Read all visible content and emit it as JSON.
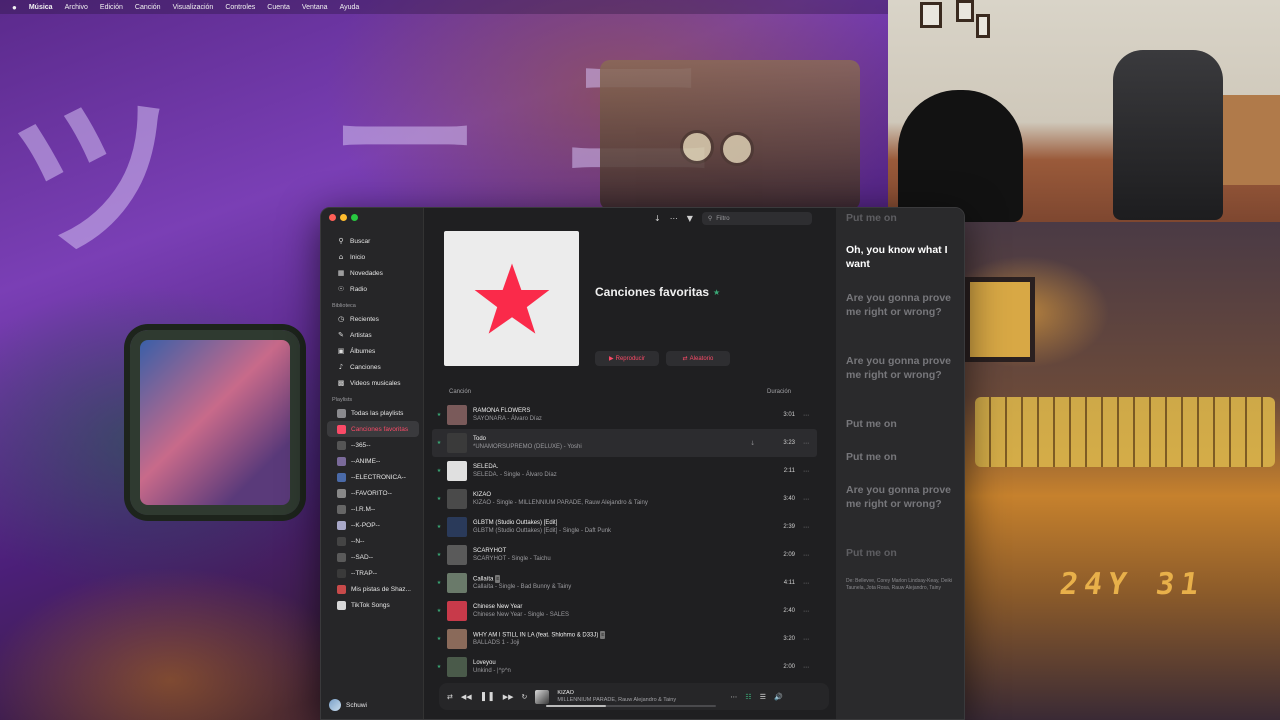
{
  "menubar": {
    "apple": "",
    "items": [
      "Música",
      "Archivo",
      "Edición",
      "Canción",
      "Visualización",
      "Controles",
      "Cuenta",
      "Ventana",
      "Ayuda"
    ]
  },
  "sidebar": {
    "main": [
      {
        "label": "Buscar",
        "icon": "search-icon"
      },
      {
        "label": "Inicio",
        "icon": "home-icon"
      },
      {
        "label": "Novedades",
        "icon": "grid-icon"
      },
      {
        "label": "Radio",
        "icon": "radio-icon"
      }
    ],
    "library_heading": "Biblioteca",
    "library": [
      {
        "label": "Recientes",
        "icon": "clock-icon"
      },
      {
        "label": "Artistas",
        "icon": "mic-icon"
      },
      {
        "label": "Álbumes",
        "icon": "album-icon"
      },
      {
        "label": "Canciones",
        "icon": "note-icon"
      },
      {
        "label": "Videos musicales",
        "icon": "video-icon"
      }
    ],
    "playlists_heading": "Playlists",
    "playlists": [
      {
        "label": "Todas las playlists",
        "color": "#8a8a8e"
      },
      {
        "label": "Canciones favoritas",
        "color": "#fa4a67",
        "active": true
      },
      {
        "label": "--365--",
        "color": "#555"
      },
      {
        "label": "--ANIME--",
        "color": "#7a6a9a"
      },
      {
        "label": "--ELECTRONICA--",
        "color": "#4a6aa8"
      },
      {
        "label": "--FAVORITO--",
        "color": "#888"
      },
      {
        "label": "--I.R.M--",
        "color": "#666"
      },
      {
        "label": "--K-POP--",
        "color": "#a8a8c8"
      },
      {
        "label": "--N--",
        "color": "#444"
      },
      {
        "label": "--SAD--",
        "color": "#5a5a5a"
      },
      {
        "label": "--TRAP--",
        "color": "#3a3a3a"
      },
      {
        "label": "Mis pistas de Shaz...",
        "color": "#c84a4a"
      },
      {
        "label": "TikTok Songs",
        "color": "#d8d8d8"
      }
    ],
    "user": "Schuwi"
  },
  "toolbar": {
    "filter_placeholder": "Filtro"
  },
  "playlist": {
    "title": "Canciones favoritas",
    "play_label": "Reproducir",
    "shuffle_label": "Aleatorio",
    "col_song": "Canción",
    "col_duration": "Duración"
  },
  "tracks": [
    {
      "name": "RAMONA FLOWERS",
      "sub": "SAYONARA - Álvaro Díaz",
      "dur": "3:01",
      "art": "#7a5a5a"
    },
    {
      "name": "Todo",
      "sub": "*UNAMORSUPREMO (DELUXE) - Yoshi",
      "dur": "3:23",
      "art": "#3a3a3a",
      "hl": true,
      "download": true
    },
    {
      "name": "SELEDA.",
      "sub": "SELEDA. - Single - Álvaro Díaz",
      "dur": "2:11",
      "art": "#e0e0e0"
    },
    {
      "name": "KIZAO",
      "sub": "KIZAO - Single - MILLENNIUM PARADE, Rauw Alejandro & Tainy",
      "dur": "3:40",
      "art": "#4a4a4a"
    },
    {
      "name": "GLBTM (Studio Outtakes) [Edit]",
      "sub": "GLBTM (Studio Outtakes) [Edit] - Single - Daft Punk",
      "dur": "2:39",
      "art": "#2a3a5a"
    },
    {
      "name": "SCARYHOT",
      "sub": "SCARYHOT - Single - Taichu",
      "dur": "2:09",
      "art": "#5a5a5a"
    },
    {
      "name": "Callaíta",
      "sub": "Callaíta - Single - Bad Bunny & Tainy",
      "dur": "4:11",
      "art": "#6a7a6a",
      "explicit": true
    },
    {
      "name": "Chinese New Year",
      "sub": "Chinese New Year - Single - SALES",
      "dur": "2:40",
      "art": "#c83a4a"
    },
    {
      "name": "WHY AM I STILL IN LA (feat. Shlohmo & D33J)",
      "sub": "BALLADS 1 - Joji",
      "dur": "3:20",
      "art": "#8a6a5a",
      "explicit": true
    },
    {
      "name": "Loveyou",
      "sub": "Unkind - |^p^n",
      "dur": "2:00",
      "art": "#4a5a4a"
    }
  ],
  "player": {
    "title": "KIZAO",
    "artist": "MILLENNIUM PARADE, Rauw Alejandro & Tainy",
    "progress": 0.35
  },
  "lyrics": {
    "lines": [
      {
        "text": "Put me on",
        "state": "faint"
      },
      {
        "text": "Oh, you know what I want",
        "state": "cur"
      },
      {
        "text": "Are you gonna prove me right or wrong?",
        "state": "dim"
      },
      {
        "text": "Are you gonna prove me right or wrong?",
        "state": "dim"
      },
      {
        "text": "Put me on",
        "state": "dim"
      },
      {
        "text": "Put me on",
        "state": "dim"
      },
      {
        "text": "Are you gonna prove me right or wrong?",
        "state": "dim"
      },
      {
        "text": "Put me on",
        "state": "faint"
      }
    ],
    "credits": "De: Bellevve, Corey Marlon Lindsay-Keay, Deiki Taunela, Jota Rosa, Rauw Alejandro, Tainy"
  },
  "colors": {
    "accent": "#fa4a67",
    "favorite": "#3aaa77"
  }
}
